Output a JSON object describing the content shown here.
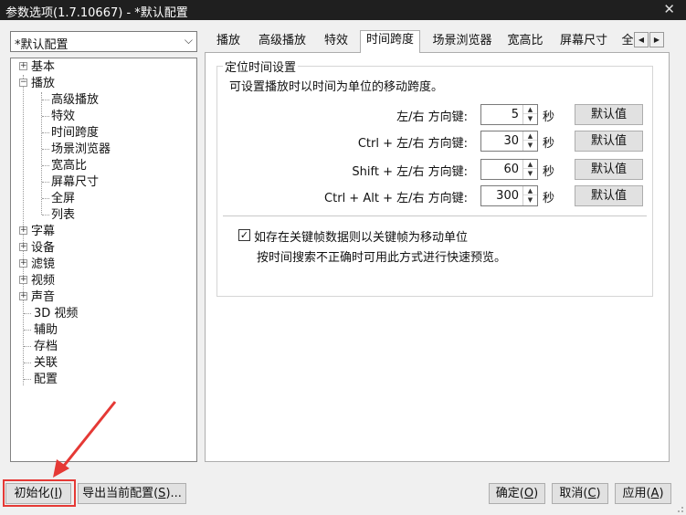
{
  "window": {
    "title": "参数选项(1.7.10667) - *默认配置",
    "close": "✕"
  },
  "preset": {
    "value": "*默认配置"
  },
  "tree": {
    "items": [
      {
        "label": "基本",
        "expander": "+"
      },
      {
        "label": "播放",
        "expander": "−"
      },
      {
        "label": "高级播放"
      },
      {
        "label": "特效"
      },
      {
        "label": "时间跨度"
      },
      {
        "label": "场景浏览器"
      },
      {
        "label": "宽高比"
      },
      {
        "label": "屏幕尺寸"
      },
      {
        "label": "全屏"
      },
      {
        "label": "列表"
      },
      {
        "label": "字幕",
        "expander": "+"
      },
      {
        "label": "设备",
        "expander": "+"
      },
      {
        "label": "滤镜",
        "expander": "+"
      },
      {
        "label": "视频",
        "expander": "+"
      },
      {
        "label": "声音",
        "expander": "+"
      },
      {
        "label": "3D 视频"
      },
      {
        "label": "辅助"
      },
      {
        "label": "存档"
      },
      {
        "label": "关联"
      },
      {
        "label": "配置"
      }
    ]
  },
  "tabs": [
    "播放",
    "高级播放",
    "特效",
    "时间跨度",
    "场景浏览器",
    "宽高比",
    "屏幕尺寸",
    "全"
  ],
  "active_tab": "时间跨度",
  "group": {
    "title": "定位时间设置",
    "description": "可设置播放时以时间为单位的移动跨度。",
    "rows": [
      {
        "label": "左/右 方向键:",
        "value": "5",
        "unit": "秒",
        "default_label": "默认值"
      },
      {
        "label": "Ctrl + 左/右 方向键:",
        "value": "30",
        "unit": "秒",
        "default_label": "默认值"
      },
      {
        "label": "Shift + 左/右 方向键:",
        "value": "60",
        "unit": "秒",
        "default_label": "默认值"
      },
      {
        "label": "Ctrl + Alt + 左/右 方向键:",
        "value": "300",
        "unit": "秒",
        "default_label": "默认值"
      }
    ],
    "keyframe_checkbox": {
      "checked": true,
      "label": "如存在关键帧数据则以关键帧为移动单位",
      "description": "按时间搜索不正确时可用此方式进行快速预览。"
    }
  },
  "bottom": {
    "init": {
      "text": "初始化(",
      "key": "I",
      "end": ")"
    },
    "export": {
      "text": "导出当前配置(",
      "key": "S",
      "end": ")..."
    },
    "ok": {
      "text": "确定(",
      "key": "O",
      "end": ")"
    },
    "cancel": {
      "text": "取消(",
      "key": "C",
      "end": ")"
    },
    "apply": {
      "text": "应用(",
      "key": "A",
      "end": ")"
    }
  },
  "annotation": {
    "highlight_color": "#e53935"
  }
}
